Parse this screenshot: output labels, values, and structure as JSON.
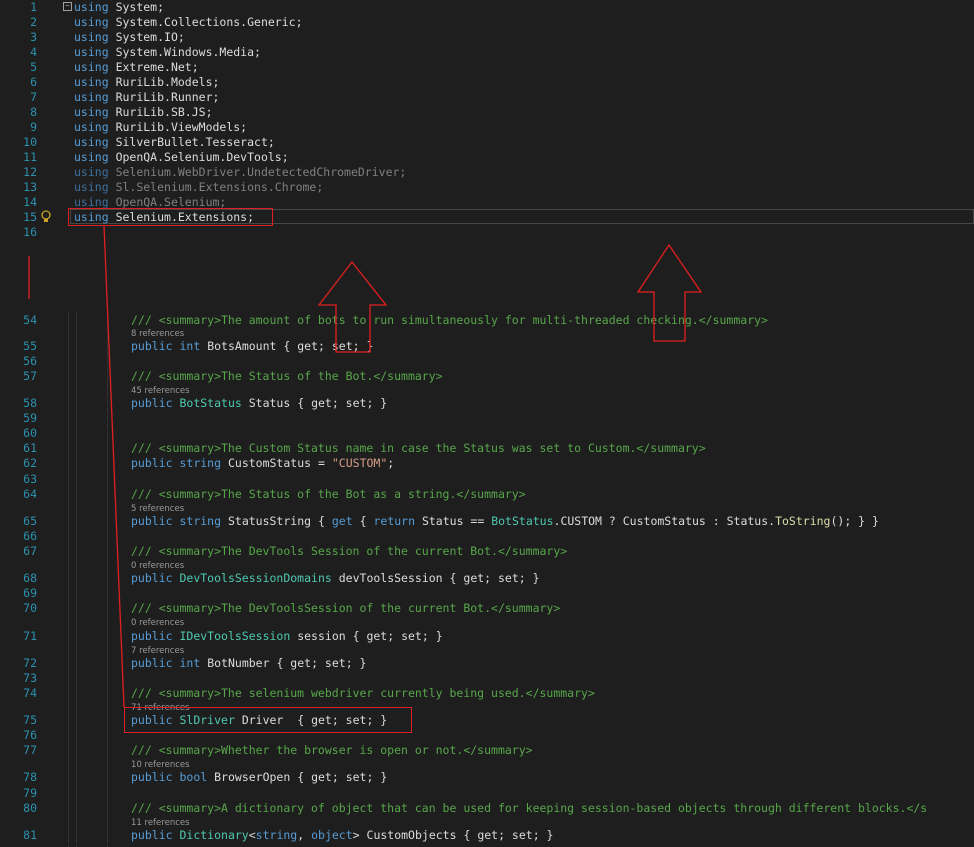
{
  "using_lines": [
    {
      "num": "1",
      "kw": "using",
      "ns": "System;"
    },
    {
      "num": "2",
      "kw": "using",
      "ns": "System.Collections.Generic;"
    },
    {
      "num": "3",
      "kw": "using",
      "ns": "System.IO;"
    },
    {
      "num": "4",
      "kw": "using",
      "ns": "System.Windows.Media;"
    },
    {
      "num": "5",
      "kw": "using",
      "ns": "Extreme.Net;"
    },
    {
      "num": "6",
      "kw": "using",
      "ns": "RuriLib.Models;"
    },
    {
      "num": "7",
      "kw": "using",
      "ns": "RuriLib.Runner;"
    },
    {
      "num": "8",
      "kw": "using",
      "ns": "RuriLib.SB.JS;"
    },
    {
      "num": "9",
      "kw": "using",
      "ns": "RuriLib.ViewModels;"
    },
    {
      "num": "10",
      "kw": "using",
      "ns": "SilverBullet.Tesseract;"
    },
    {
      "num": "11",
      "kw": "using",
      "ns": "OpenQA.Selenium.DevTools;"
    },
    {
      "num": "12",
      "kw": "using",
      "ns": "Selenium.WebDriver.UndetectedChromeDriver;"
    },
    {
      "num": "13",
      "kw": "using",
      "ns": "Sl.Selenium.Extensions.Chrome;"
    },
    {
      "num": "14",
      "kw": "using",
      "ns": "OpenQA.Selenium;"
    },
    {
      "num": "15",
      "kw": "using",
      "ns": "Selenium.Extensions;"
    },
    {
      "num": "16"
    }
  ],
  "code_lines": {
    "l54": {
      "num": "54",
      "comment": "/// <summary>The amount of bots to run simultaneously for multi-threaded checking.</summary>"
    },
    "r55": "8 references",
    "l55": {
      "num": "55",
      "kw1": "public",
      "kw2": "int",
      "name": "BotsAmount",
      "acc": "{ get; set; }"
    },
    "l56": {
      "num": "56"
    },
    "l57": {
      "num": "57",
      "comment": "/// <summary>The Status of the Bot.</summary>"
    },
    "r58": "45 references",
    "l58": {
      "num": "58",
      "kw1": "public",
      "type": "BotStatus",
      "name": "Status",
      "acc": "{ get; set; }"
    },
    "l59": {
      "num": "59"
    },
    "l60": {
      "num": "60"
    },
    "l61": {
      "num": "61",
      "comment": "/// <summary>The Custom Status name in case the Status was set to Custom.</summary>"
    },
    "l62": {
      "num": "62",
      "kw1": "public",
      "kw2": "string",
      "name": "CustomStatus",
      "eq": "=",
      "str": "\"CUSTOM\"",
      "end": ";"
    },
    "l63": {
      "num": "63"
    },
    "l64": {
      "num": "64",
      "comment": "/// <summary>The Status of the Bot as a string.</summary>"
    },
    "r65": "5 references",
    "l65": {
      "num": "65",
      "kw1": "public",
      "kw2": "string",
      "name": "StatusString",
      "p1": "{",
      "get": "get",
      "p2": "{",
      "ret": "return",
      "p3": "Status ==",
      "type": "BotStatus",
      "p4": ".CUSTOM ? CustomStatus : Status.",
      "mth": "ToString",
      "p5": "(); } }"
    },
    "l66": {
      "num": "66"
    },
    "l67": {
      "num": "67",
      "comment": "/// <summary>The DevTools Session of the current Bot.</summary>"
    },
    "r68": "0 references",
    "l68": {
      "num": "68",
      "kw1": "public",
      "type": "DevToolsSessionDomains",
      "name": "devToolsSession",
      "acc": "{ get; set; }"
    },
    "l69": {
      "num": "69"
    },
    "l70": {
      "num": "70",
      "comment": "/// <summary>The DevToolsSession of the current Bot.</summary>"
    },
    "r71": "0 references",
    "l71": {
      "num": "71",
      "kw1": "public",
      "type": "IDevToolsSession",
      "name": "session",
      "acc": "{ get; set; }"
    },
    "r72": "7 references",
    "l72": {
      "num": "72",
      "kw1": "public",
      "kw2": "int",
      "name": "BotNumber",
      "acc": "{ get; set; }"
    },
    "l73": {
      "num": "73"
    },
    "l74": {
      "num": "74",
      "comment": "/// <summary>The selenium webdriver currently being used.</summary>"
    },
    "r75": "71 references",
    "l75": {
      "num": "75",
      "kw1": "public",
      "type": "SlDriver",
      "name": "Driver ",
      "acc": "{ get; set; }"
    },
    "l76": {
      "num": "76"
    },
    "l77": {
      "num": "77",
      "comment": "/// <summary>Whether the browser is open or not.</summary>"
    },
    "r78": "10 references",
    "l78": {
      "num": "78",
      "kw1": "public",
      "kw2": "bool",
      "name": "BrowserOpen",
      "acc": "{ get; set; }"
    },
    "l79": {
      "num": "79"
    },
    "l80": {
      "num": "80",
      "comment": "/// <summary>A dictionary of object that can be used for keeping session-based objects through different blocks.</s"
    },
    "r81": "11 references",
    "l81": {
      "num": "81",
      "kw1": "public",
      "type": "Dictionary",
      "lt": "<",
      "kw2": "string",
      "comma": ",",
      "kw3": "object",
      "gt": ">",
      "name": "CustomObjects",
      "acc": "{ get; set; }"
    }
  },
  "colors": {
    "background": "#1e1e1e",
    "keyword": "#569cd6",
    "comment": "#57a64a",
    "type": "#4ec9b0",
    "string": "#d69d85",
    "line_number": "#2b91af",
    "annotation_red": "#e02020"
  },
  "icons": {
    "collapse": "collapse-minus-icon",
    "lightbulb": "lightbulb-icon"
  }
}
